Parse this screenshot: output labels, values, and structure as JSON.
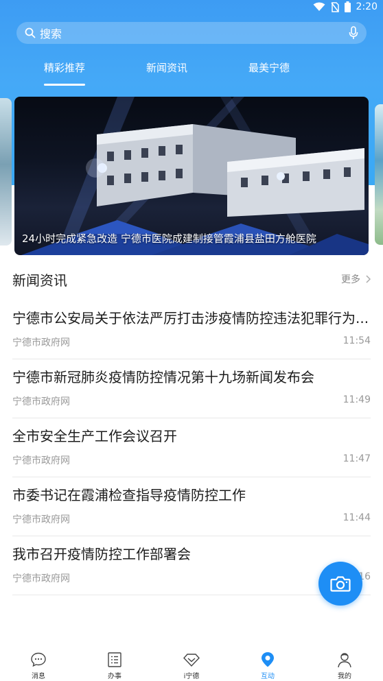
{
  "status_bar": {
    "time": "2:20",
    "icons": [
      "wifi-icon",
      "no-sim-icon",
      "battery-icon"
    ]
  },
  "search": {
    "placeholder": "搜索",
    "icons": [
      "search-icon",
      "mic-icon"
    ]
  },
  "tabs": [
    {
      "label": "精彩推荐",
      "active": true
    },
    {
      "label": "新闻资讯",
      "active": false
    },
    {
      "label": "最美宁德",
      "active": false
    }
  ],
  "banner": {
    "caption": "24小时完成紧急改造 宁德市医院成建制接管霞浦县盐田方舱医院"
  },
  "news_section": {
    "title": "新闻资讯",
    "more_label": "更多",
    "items": [
      {
        "title": "宁德市公安局关于依法严厉打击涉疫情防控违法犯罪行为...",
        "source": "宁德市政府网",
        "time": "11:54"
      },
      {
        "title": "宁德市新冠肺炎疫情防控情况第十九场新闻发布会",
        "source": "宁德市政府网",
        "time": "11:49"
      },
      {
        "title": "全市安全生产工作会议召开",
        "source": "宁德市政府网",
        "time": "11:47"
      },
      {
        "title": "市委书记在霞浦检查指导疫情防控工作",
        "source": "宁德市政府网",
        "time": "11:44"
      },
      {
        "title": "我市召开疫情防控工作部署会",
        "source": "宁德市政府网",
        "time": "11:16"
      }
    ]
  },
  "fab": {
    "icon": "camera-icon"
  },
  "bottom_nav": [
    {
      "label": "消息",
      "icon": "chat-icon",
      "active": false
    },
    {
      "label": "办事",
      "icon": "list-icon",
      "active": false
    },
    {
      "label": "i宁德",
      "icon": "diamond-icon",
      "active": false
    },
    {
      "label": "互动",
      "icon": "location-pin-icon",
      "active": true
    },
    {
      "label": "我的",
      "icon": "user-icon",
      "active": false
    }
  ],
  "colors": {
    "header_blue": "#3d9cf3",
    "accent": "#1e8ef5"
  }
}
